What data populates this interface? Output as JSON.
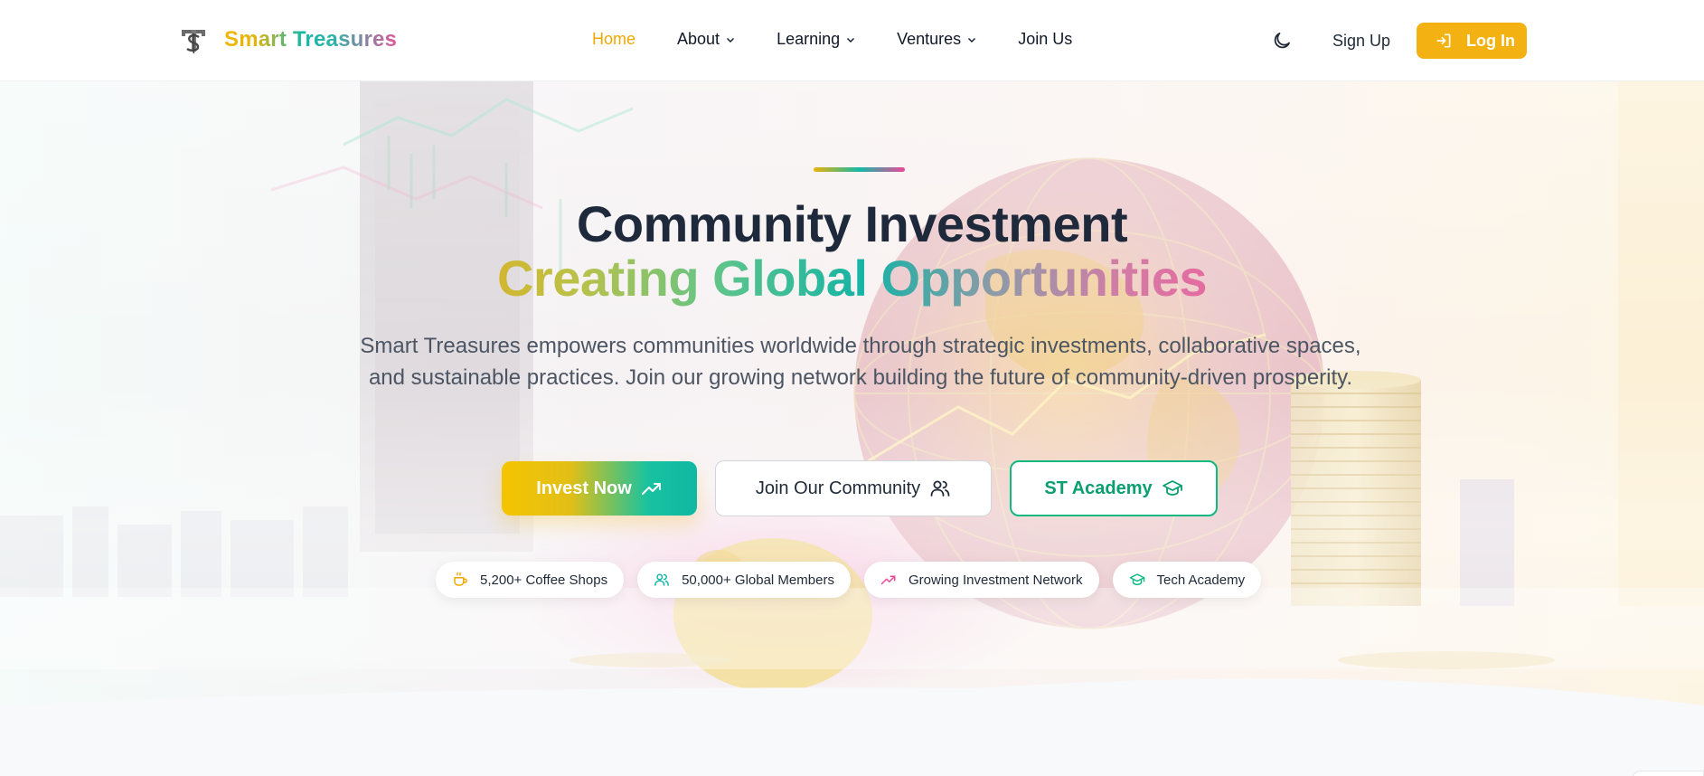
{
  "brand": {
    "name": "Smart Treasures",
    "logo_icon": "st-dollar-logo"
  },
  "nav": {
    "items": [
      {
        "label": "Home",
        "active": true,
        "has_dropdown": false
      },
      {
        "label": "About",
        "active": false,
        "has_dropdown": true
      },
      {
        "label": "Learning",
        "active": false,
        "has_dropdown": true
      },
      {
        "label": "Ventures",
        "active": false,
        "has_dropdown": true
      },
      {
        "label": "Join Us",
        "active": false,
        "has_dropdown": false
      }
    ],
    "theme_icon": "moon-icon",
    "signup_label": "Sign Up",
    "login_label": "Log In",
    "login_icon": "login-icon"
  },
  "hero": {
    "title_line1": "Community Investment",
    "title_line2": "Creating Global Opportunities",
    "subtitle": "Smart Treasures empowers communities worldwide through strategic investments, collaborative spaces, and sustainable practices. Join our growing network building the future of community-driven prosperity.",
    "buttons": {
      "invest": {
        "label": "Invest Now",
        "icon": "trending-up-icon"
      },
      "community": {
        "label": "Join Our Community",
        "icon": "users-icon"
      },
      "academy": {
        "label": "ST Academy",
        "icon": "graduation-cap-icon"
      }
    },
    "badges": [
      {
        "label": "5,200+ Coffee Shops",
        "icon": "coffee-icon",
        "color": "#f0a800"
      },
      {
        "label": "50,000+ Global Members",
        "icon": "users-icon",
        "color": "#14b8a6"
      },
      {
        "label": "Growing Investment Network",
        "icon": "trending-up-icon",
        "color": "#ec4899"
      },
      {
        "label": "Tech Academy",
        "icon": "graduation-cap-icon",
        "color": "#10b981"
      }
    ]
  },
  "colors": {
    "accent": "#f3b211",
    "teal": "#14b8a6",
    "pink": "#ec4899",
    "green": "#10b981",
    "heading": "#1e293b"
  }
}
